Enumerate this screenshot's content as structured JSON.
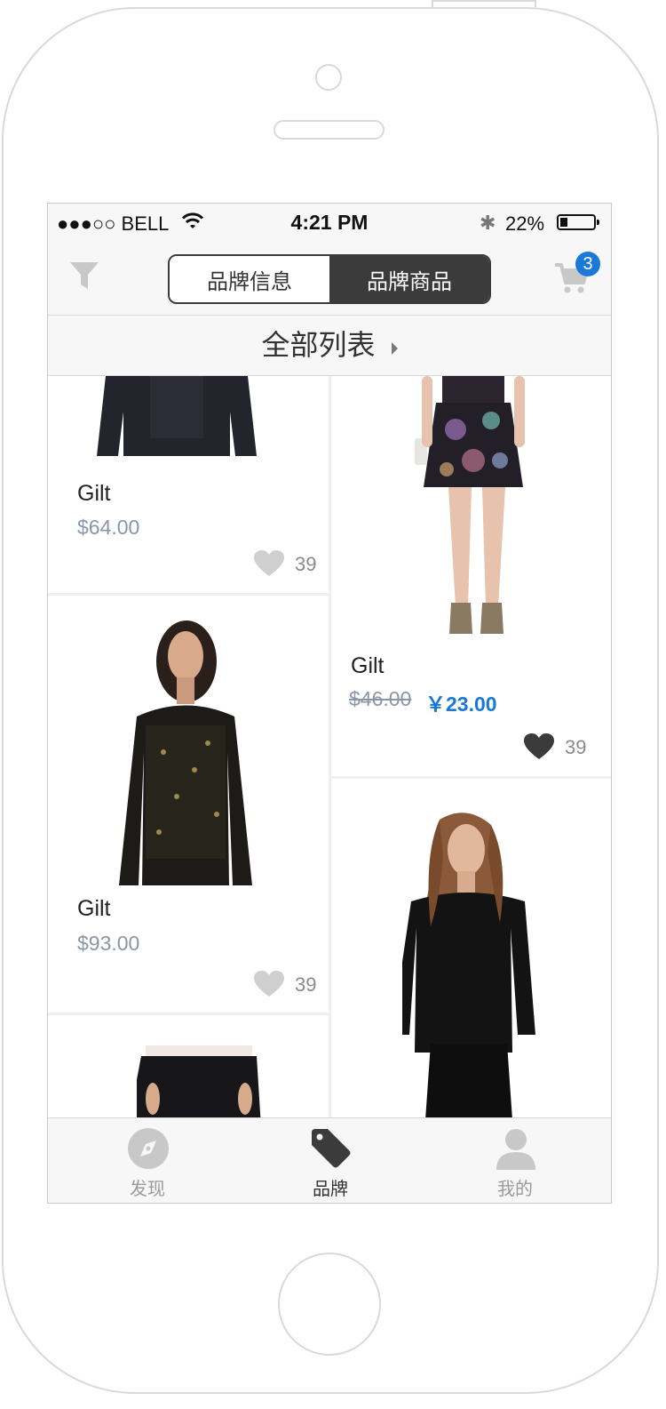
{
  "status": {
    "carrier": "●●●○○ BELL",
    "time": "4:21 PM",
    "battery": "22%",
    "battery_level": 0.22
  },
  "navbar": {
    "segments": [
      "品牌信息",
      "品牌商品"
    ],
    "active_segment": 1,
    "cart_badge": "3"
  },
  "subheader": {
    "title": "全部列表"
  },
  "products": [
    {
      "brand": "Gilt",
      "price": "$64.00",
      "likes": "39",
      "liked": false
    },
    {
      "brand": "Gilt",
      "original_price": "$46.00",
      "sale_price": "￥23.00",
      "likes": "39",
      "liked": true
    },
    {
      "brand": "Gilt",
      "price": "$93.00",
      "likes": "39",
      "liked": false
    }
  ],
  "tabbar": {
    "tabs": [
      {
        "label": "发现",
        "icon": "compass-icon"
      },
      {
        "label": "品牌",
        "icon": "tag-icon"
      },
      {
        "label": "我的",
        "icon": "person-icon"
      }
    ],
    "active_tab": 1
  },
  "colors": {
    "accent": "#1a78d6",
    "segment_active": "#3b3b3b",
    "price_gray": "#8a96a8"
  }
}
